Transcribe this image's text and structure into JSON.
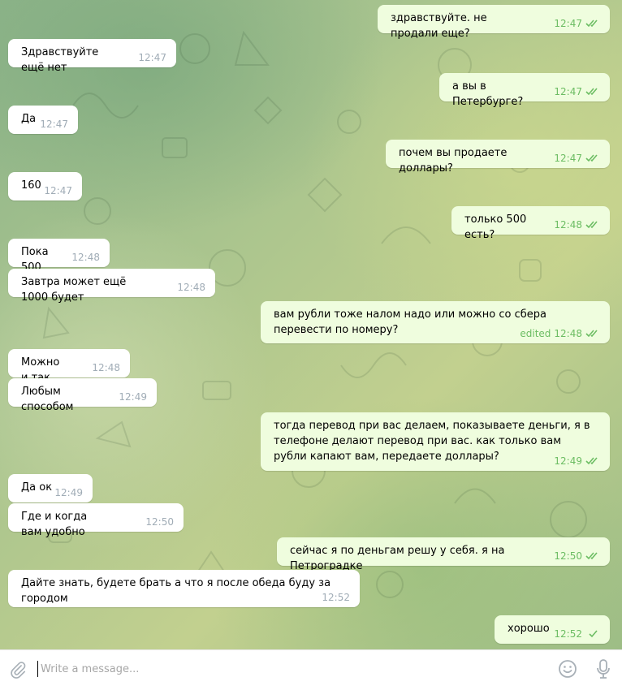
{
  "composer": {
    "placeholder": "Write a message..."
  },
  "messages": [
    {
      "dir": "out",
      "text": "здравствуйте. не продали еще?",
      "time": "12:47",
      "status": "read"
    },
    {
      "dir": "in",
      "text": "Здравствуйте ещё нет",
      "time": "12:47"
    },
    {
      "dir": "out",
      "text": "а вы в Петербурге?",
      "time": "12:47",
      "status": "read"
    },
    {
      "dir": "in",
      "text": "Да",
      "time": "12:47"
    },
    {
      "dir": "out",
      "text": "почем вы продаете доллары?",
      "time": "12:47",
      "status": "read"
    },
    {
      "dir": "in",
      "text": "160",
      "time": "12:47"
    },
    {
      "dir": "out",
      "text": "только 500 есть?",
      "time": "12:48",
      "status": "read"
    },
    {
      "dir": "in",
      "text": "Пока 500",
      "time": "12:48"
    },
    {
      "dir": "in",
      "text": "Завтра может ещё 1000 будет",
      "time": "12:48"
    },
    {
      "dir": "out",
      "text": "вам рубли тоже налом надо или можно со сбера перевести по номеру?",
      "edited": "edited",
      "time": "12:48",
      "status": "read"
    },
    {
      "dir": "in",
      "text": "Можно и так",
      "time": "12:48"
    },
    {
      "dir": "in",
      "text": "Любым способом",
      "time": "12:49"
    },
    {
      "dir": "out",
      "text": "тогда перевод при вас делаем, показываете деньги, я в телефоне делают перевод при вас.  как только вам рубли капают вам, передаете доллары?",
      "time": "12:49",
      "status": "read"
    },
    {
      "dir": "in",
      "text": "Да ок",
      "time": "12:49"
    },
    {
      "dir": "in",
      "text": "Где и когда вам удобно",
      "time": "12:50"
    },
    {
      "dir": "out",
      "text": "сейчас я по деньгам решу у себя. я на Петроградке",
      "time": "12:50",
      "status": "read"
    },
    {
      "dir": "in",
      "text": "Дайте знать, будете брать а что я после обеда буду за городом",
      "time": "12:52"
    },
    {
      "dir": "out",
      "text": "хорошо",
      "time": "12:52",
      "status": "sent"
    }
  ]
}
